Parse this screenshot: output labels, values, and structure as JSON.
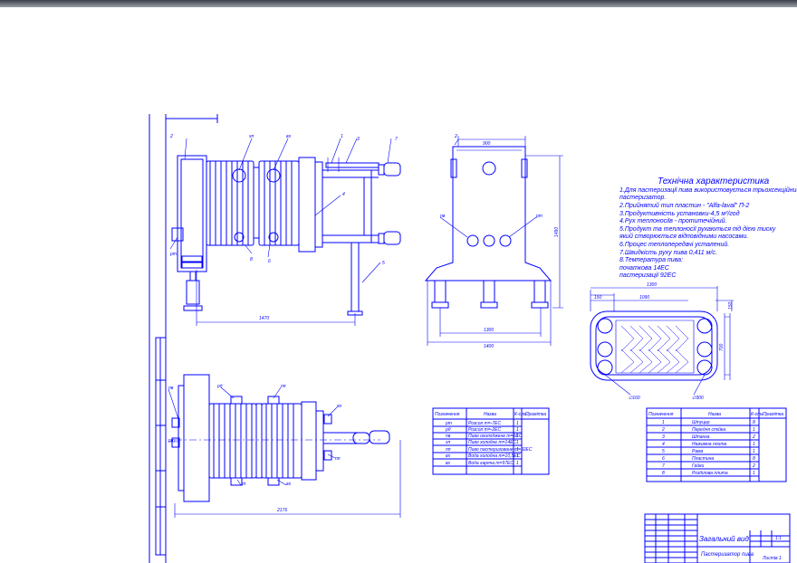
{
  "tech": {
    "title": "Технічна характеристика",
    "lines": [
      "1.Для пастеризації пива використовується трьохсекційний",
      " пастеризатор.",
      "2.Прийнятий тип пластин - \"Alfa-laval\" П-2",
      "3.Продуктивність установки-4,5 м³/год",
      "4.Рух теплоносіїв - протитечійний.",
      "5.Продукт та теплоносії рухаються під дією тиску",
      " який створюється відповідними насосами.",
      "6.Процес теплопередачі усталений.",
      "7.Швидкість руху пива 0,411 м/с.",
      "8.Температура пива:",
      " початкова 14ЕС",
      " пастеризації 92ЕС"
    ]
  },
  "dims": {
    "top_length": "1470",
    "bottom_length": "2176",
    "side_width_top": "900",
    "side_height": "1490",
    "side_base": "1300",
    "side_total": "1400",
    "plate_width": "1090",
    "plate_width2": "1300",
    "plate_offset": "150",
    "plate_top": "150",
    "plate_height": "700",
    "port_left": "∅160",
    "port_right": "∅300"
  },
  "leaders_top": [
    "2",
    "хп",
    "вх",
    "1",
    "3",
    "7",
    "4",
    "8",
    "6",
    "5",
    "рт"
  ],
  "leaders_side": [
    "2",
    "пв",
    "рт"
  ],
  "leaders_bottom": [
    "пв",
    "рт",
    "рд",
    "пп",
    "вх",
    "хп",
    "вх",
    "пп"
  ],
  "table1": {
    "headers": [
      "Позначення",
      "Назва",
      "К-сть",
      "Примітка"
    ],
    "rows": [
      [
        "рт",
        "Розсол т=-7ЕС",
        "1",
        ""
      ],
      [
        "рд",
        "Розсол т=-2ЕС",
        "1",
        ""
      ],
      [
        "пв",
        "Пиво охолоджене т=1ЕС",
        "1",
        ""
      ],
      [
        "хп",
        "Пиво холодне т=14ЕС",
        "1",
        ""
      ],
      [
        "пп",
        "Пиво пастеризоване т=92ЕС",
        "1",
        ""
      ],
      [
        "вх",
        "Вода холодна т=10,5ЕС",
        "1",
        ""
      ],
      [
        "вз",
        "Вода гаряча т=97ЕС",
        "1",
        ""
      ]
    ]
  },
  "table2": {
    "headers": [
      "Позначення",
      "Назва",
      "К-сть",
      "Примітка"
    ],
    "rows": [
      [
        "1",
        "Штуцер",
        "8",
        ""
      ],
      [
        "2",
        "Передня стійка",
        "1",
        ""
      ],
      [
        "3",
        "Штанга",
        "2",
        ""
      ],
      [
        "4",
        "Нажимна плита",
        "1",
        ""
      ],
      [
        "5",
        "Рама",
        "1",
        ""
      ],
      [
        "6",
        "Пластина",
        "8",
        ""
      ],
      [
        "7",
        "Гайки",
        "2",
        ""
      ],
      [
        "8",
        "Розділова плита",
        "1",
        ""
      ]
    ]
  },
  "stamp": {
    "main_title": "Загальний вид",
    "sub_title": "Пастеризатор пива",
    "sheet": "1:1",
    "sheets_label": "Листів 1"
  }
}
